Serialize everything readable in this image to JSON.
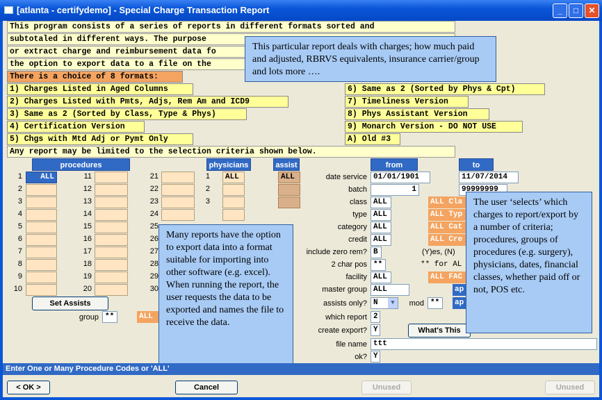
{
  "window": {
    "title": "[atlanta - certifydemo] - Special Charge Transaction Report",
    "min": "_",
    "max": "□",
    "close": "✕"
  },
  "intro": [
    "This program consists of a series of reports in different formats sorted and",
    "subtotaled in different ways.  The purpose",
    "or extract charge and reimbursement data fo",
    "the option to export data to a file on the"
  ],
  "choice_header": "There is a choice of 8 formats:",
  "formats_left": [
    "1) Charges Listed in Aged Columns",
    "2) Charges Listed with Pmts, Adjs, Rem Am and ICD9",
    "3) Same as 2 (Sorted by Class, Type & Phys)",
    "4) Certification Version",
    "5) Chgs with Mtd Adj or Pymt Only"
  ],
  "formats_right": [
    "6) Same as 2 (Sorted by Phys & Cpt)",
    "7) Timeliness Version",
    "8) Phys Assistant Version",
    "9) Monarch Version - DO NOT USE",
    "A) Old #3"
  ],
  "selection_note": "Any report may be limited to the selection criteria  shown below.",
  "headers": {
    "procedures": "procedures",
    "physicians": "physicians",
    "assist": "assist",
    "from": "from",
    "to": "to"
  },
  "procedures": {
    "col1": [
      "1",
      "2",
      "3",
      "4",
      "5",
      "6",
      "7",
      "8",
      "9",
      "10"
    ],
    "col2": [
      "11",
      "12",
      "13",
      "14",
      "15",
      "16",
      "17",
      "18",
      "19",
      "20"
    ],
    "col3": [
      "21",
      "22",
      "23",
      "24",
      "25",
      "26",
      "27",
      "28",
      "29",
      "30"
    ],
    "first_value": "ALL"
  },
  "physicians": {
    "nums": [
      "1",
      "2",
      "3"
    ],
    "first_value": "ALL"
  },
  "assist_first": "ALL",
  "criteria": {
    "date_service_label": "date service",
    "date_from": "01/01/1901",
    "date_to": "11/07/2014",
    "batch_label": "batch",
    "batch_from": "1",
    "batch_to": "99999999",
    "class_label": "class",
    "class_value": "ALL",
    "class_side": "ALL Cla",
    "type_label": "type",
    "type_value": "ALL",
    "type_side": "ALL Typ",
    "category_label": "category",
    "category_value": "ALL",
    "category_side": "ALL Cat",
    "credit_label": "credit",
    "credit_value": "ALL",
    "credit_side": "ALL Cre",
    "include_zero_label": "include zero rem?",
    "include_zero_value": "B",
    "include_zero_hint": "(Y)es, (N)",
    "char_pos_label": "2 char pos",
    "char_pos_value": "**",
    "char_pos_hint": "** for AL",
    "facility_label": "facility",
    "facility_value": "ALL",
    "facility_side": "ALL FAC",
    "master_group_label": "master group",
    "master_group_value": "ALL",
    "master_group_side": "ap",
    "assists_only_label": "assists only?",
    "assists_only_value": "N",
    "mod_label": "mod",
    "mod_value": "**",
    "mod_side": "ap",
    "which_report_label": "which report",
    "which_report_value": "2",
    "create_export_label": "create export?",
    "create_export_value": "Y",
    "file_name_label": "file name",
    "file_name_value": "ttt",
    "ok_label": "ok?",
    "ok_value": "Y"
  },
  "group_label": "group",
  "group_value": "**",
  "group_side": "ALL",
  "buttons": {
    "set_assists": "Set Assists",
    "whats_this": "What's This",
    "ok": "< OK >",
    "cancel": "Cancel",
    "unused1": "Unused",
    "unused2": "Unused"
  },
  "callouts": {
    "top": "This particular report deals with charges; how much paid and adjusted, RBRVS equivalents, insurance carrier/group and lots more ….",
    "middle": "Many reports have the option to export data into a format suitable for importing into other software (e.g. excel). When running the report, the user requests the data to be exported and names the file to receive the data.",
    "right": "The user ‘selects’ which charges to report/export by a number of criteria; procedures, groups of procedures (e.g. surgery), physicians, dates, financial classes, whether paid off or not, POS etc."
  },
  "status": "Enter One or Many Procedure Codes or 'ALL'"
}
